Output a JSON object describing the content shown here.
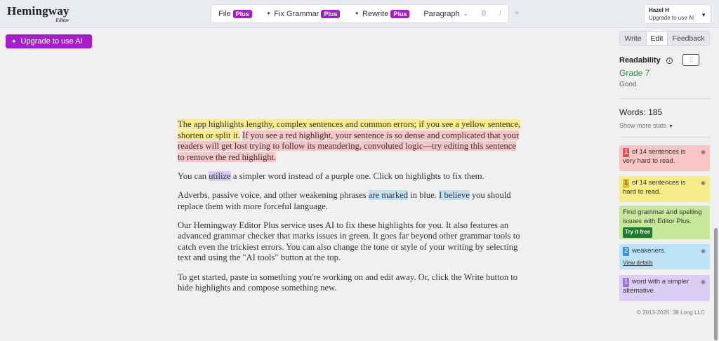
{
  "app": {
    "logo": "Hemingway",
    "logo_sub": "Editor"
  },
  "toolbar": {
    "file": "File",
    "fix_grammar": "Fix Grammar",
    "rewrite": "Rewrite",
    "plus_badge": "Plus",
    "paragraph": "Paragraph",
    "bold": "B",
    "italic": "I",
    "link": "⚭"
  },
  "account": {
    "name": "Hazel H",
    "subtitle": "Upgrade to use AI"
  },
  "ai_button": {
    "label": "Upgrade to use AI"
  },
  "editor": {
    "p1": {
      "yellow": "The app highlights lengthy, complex sentences and common errors; if you see a yellow sentence, shorten or split it.",
      "red": "If you see a red highlight, your sentence is so dense and complicated that your readers will get lost trying to follow its meandering, convoluted logic—try editing this sentence to remove the red highlight."
    },
    "p2": {
      "before": "You can ",
      "purple": "utilize",
      "after": " a simpler word instead of a purple one. Click on highlights to fix them."
    },
    "p3": {
      "before": "Adverbs, passive voice, and other weakening phrases ",
      "blue1": "are marked",
      "mid": " in blue. ",
      "blue2": "I believe",
      "after": " you should replace them with more forceful language."
    },
    "p4": "Our Hemingway Editor Plus service uses AI to fix these highlights for you. It also features an advanced grammar checker that marks issues in green. It goes far beyond other grammar tools to catch even the trickiest errors. You can also change the tone or style of your writing by selecting text and using the \"AI tools\" button at the top.",
    "p5": "To get started, paste in something you're working on and edit away. Or, click the Write button to hide highlights and compose something new."
  },
  "sidebar": {
    "tabs": {
      "write": "Write",
      "edit": "Edit",
      "feedback": "Feedback"
    },
    "readability_label": "Readability",
    "grade": "Grade 7",
    "grade_note": "Good.",
    "words": "Words: 185",
    "more_stats": "Show more stats",
    "cards": {
      "very_hard": {
        "count": "1",
        "text": "of 14 sentences is very hard to read."
      },
      "hard": {
        "count": "1",
        "text": "of 14 sentences is hard to read."
      },
      "grammar": {
        "text": "Find grammar and spelling issues with Editor Plus.",
        "button": "Try it free"
      },
      "weakeners": {
        "count": "2",
        "text": "weakeners.",
        "link": "View details"
      },
      "simpler": {
        "count": "1",
        "text": "word with a simpler alternative."
      }
    },
    "copyright": "© 2013-2025 .38 Long LLC"
  },
  "colors": {
    "accent": "#a41ec9",
    "very_hard": "#f8c4c4",
    "hard": "#f6ec8a",
    "grammar": "#c7e89a",
    "weakeners": "#bee2f8",
    "simpler": "#dccdf5",
    "grade": "#2e8b3a"
  }
}
